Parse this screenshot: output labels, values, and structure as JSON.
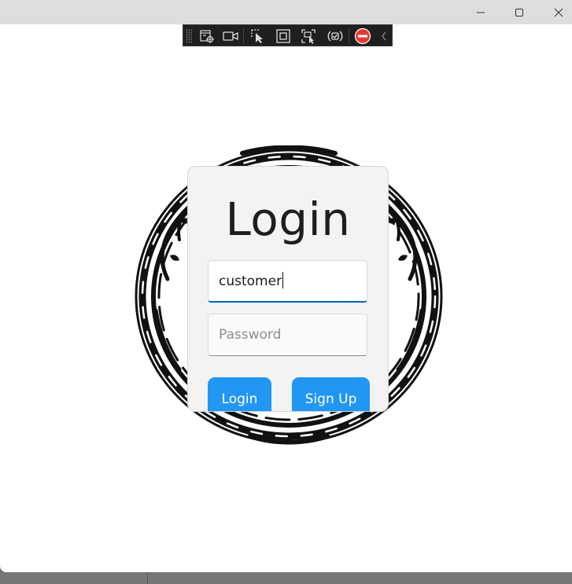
{
  "window": {
    "controls": {
      "minimize_icon": "minimize-icon",
      "maximize_icon": "maximize-icon",
      "close_icon": "close-icon"
    }
  },
  "debug_toolbar": {
    "icons": [
      "live-visual-tree-icon",
      "video-icon",
      "select-element-icon",
      "display-layout-adorners-icon",
      "track-focus-icon",
      "hot-reload-icon",
      "stop-icon",
      "collapse-chevron-icon"
    ]
  },
  "login": {
    "title": "Login",
    "username": {
      "value": "customer",
      "placeholder": ""
    },
    "password": {
      "value": "",
      "placeholder": "Password"
    },
    "login_button": "Login",
    "signup_button": "Sign Up"
  },
  "colors": {
    "accent": "#2196f3",
    "focus_underline": "#0067c0",
    "stop": "#e53935"
  }
}
